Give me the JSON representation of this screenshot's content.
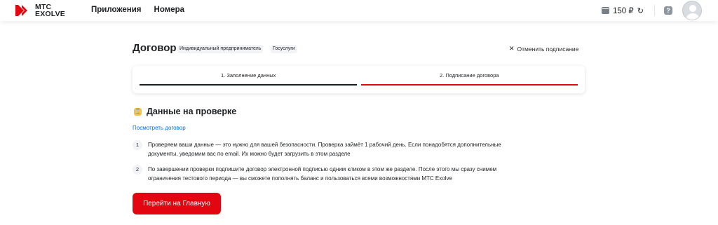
{
  "brand": {
    "line1": "МТС",
    "line2": "EXOLVE",
    "accent": "#e30611"
  },
  "nav": {
    "apps": "Приложения",
    "numbers": "Номера"
  },
  "balance": {
    "amount": "150 ₽",
    "wallet_icon": "wallet-icon",
    "refresh_icon": "refresh-icon"
  },
  "help_icon": "question-icon",
  "avatar_icon": "user-avatar-icon",
  "page": {
    "title": "Договор",
    "badges": [
      "Индивидуальный предприниматель",
      "Госуслуги"
    ],
    "cancel_label": "Отменить подписание"
  },
  "steps": [
    {
      "label": "1. Заполнение данных",
      "state": "done",
      "color": "#1d2023"
    },
    {
      "label": "2. Подписание договора",
      "state": "active",
      "color": "#e30611"
    }
  ],
  "status": {
    "title": "Данные на проверке",
    "icon": "hourglass-icon",
    "link": "Посмотреть договор"
  },
  "items": [
    {
      "num": "1",
      "text": "Проверяем ваши данные — это нужно для вашей безопасности. Проверка займёт 1 рабочий день. Если понадобятся дополнительные документы, уведомим вас по email. Их можно будет загрузить в этом разделе"
    },
    {
      "num": "2",
      "text": "По завершении проверки подпишите договор электронной подписью одним кликом в этом же разделе. После этого мы сразу снимем ограничения тестового периода — вы сможете пополнять баланс и пользоваться всеми возможностями МТС Exolve"
    }
  ],
  "cta": "Перейти на Главную"
}
